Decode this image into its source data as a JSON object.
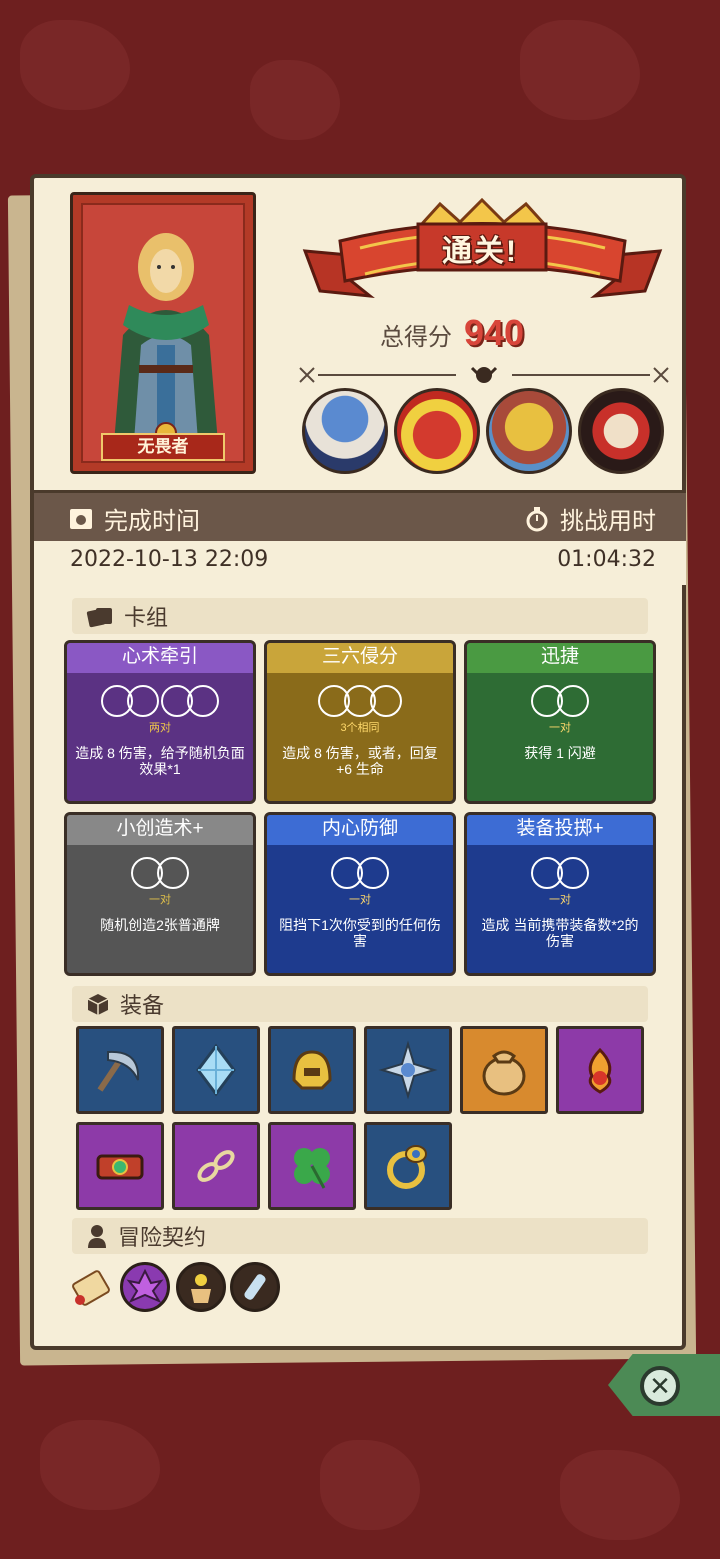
{
  "result": {
    "banner": "通关!",
    "score_label": "总得分",
    "score_value": "940"
  },
  "hero": {
    "name": "无畏者"
  },
  "time": {
    "complete_label": "完成时间",
    "complete_value": "2022-10-13  22:09",
    "challenge_label": "挑战用时",
    "challenge_value": "01:04:32"
  },
  "deck": {
    "title": "卡组",
    "cards": [
      {
        "name": "心术牵引",
        "sub": "两对",
        "desc": "造成 8 伤害，给予随机负面效果*1",
        "color": "#8a58c4"
      },
      {
        "name": "三六侵分",
        "sub": "3个相同",
        "desc": "造成 8 伤害，或者，回复 +6 生命",
        "color": "#c9a53a"
      },
      {
        "name": "迅捷",
        "sub": "一对",
        "desc": "获得 1 闪避",
        "color": "#4a9a42"
      },
      {
        "name": "小创造术+",
        "sub": "一对",
        "desc": "随机创造2张普通牌",
        "color": "#888888"
      },
      {
        "name": "内心防御",
        "sub": "一对",
        "desc": "阻挡下1次你受到的任何伤害",
        "color": "#3d6cd4"
      },
      {
        "name": "装备投掷+",
        "sub": "一对",
        "desc": "造成 当前携带装备数*2的伤害",
        "color": "#3d6cd4"
      }
    ]
  },
  "equipment": {
    "title": "装备",
    "items": [
      {
        "icon": "scythe-icon"
      },
      {
        "icon": "crystal-icon"
      },
      {
        "icon": "helmet-icon"
      },
      {
        "icon": "compass-star-icon"
      },
      {
        "icon": "coin-bag-icon"
      },
      {
        "icon": "fire-bottle-icon"
      },
      {
        "icon": "bracer-icon"
      },
      {
        "icon": "chain-icon"
      },
      {
        "icon": "clover-icon"
      },
      {
        "icon": "ring-icon"
      }
    ]
  },
  "contracts": {
    "title": "冒险契约",
    "items": [
      {
        "icon": "scroll-icon"
      },
      {
        "icon": "purple-creature-icon"
      },
      {
        "icon": "flower-pot-icon"
      },
      {
        "icon": "vial-icon"
      }
    ]
  }
}
